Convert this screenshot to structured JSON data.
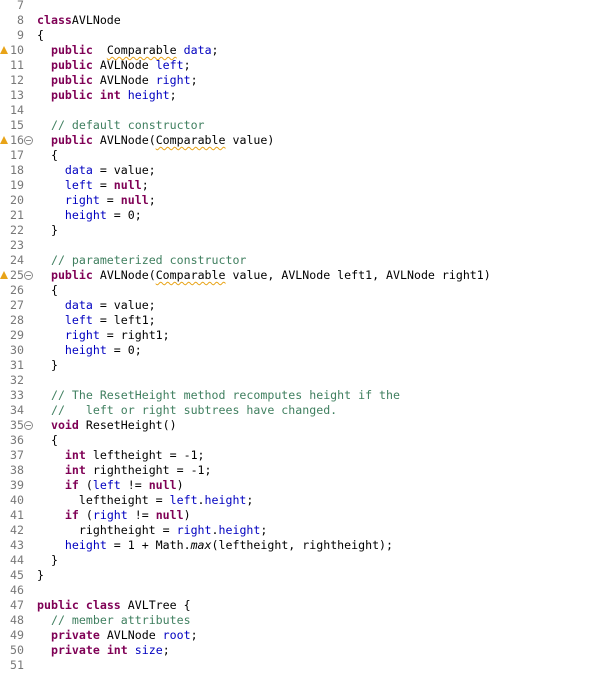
{
  "editor": {
    "language": "java",
    "first_line_number": 7,
    "colors": {
      "keyword": "#7f0055",
      "field": "#0000c0",
      "comment": "#3f7f5f",
      "line_number": "#787878",
      "warning_marker": "#e8a317"
    },
    "lines": [
      {
        "n": "7",
        "tokens": []
      },
      {
        "n": "8",
        "tokens": [
          [
            "kw",
            "class"
          ],
          [
            "",
            "AVLNode"
          ]
        ]
      },
      {
        "n": "9",
        "tokens": [
          [
            "",
            "{"
          ]
        ]
      },
      {
        "n": "10",
        "warn": true,
        "tokens": [
          [
            "",
            "  "
          ],
          [
            "kw",
            "public"
          ],
          [
            "",
            "  "
          ],
          [
            "sq",
            "Comparable"
          ],
          [
            "",
            " "
          ],
          [
            "fld",
            "data"
          ],
          [
            "",
            ";"
          ]
        ]
      },
      {
        "n": "11",
        "tokens": [
          [
            "",
            "  "
          ],
          [
            "kw",
            "public"
          ],
          [
            "",
            " AVLNode "
          ],
          [
            "fld",
            "left"
          ],
          [
            "",
            ";"
          ]
        ]
      },
      {
        "n": "12",
        "tokens": [
          [
            "",
            "  "
          ],
          [
            "kw",
            "public"
          ],
          [
            "",
            " AVLNode "
          ],
          [
            "fld",
            "right"
          ],
          [
            "",
            ";"
          ]
        ]
      },
      {
        "n": "13",
        "tokens": [
          [
            "",
            "  "
          ],
          [
            "kw",
            "public"
          ],
          [
            "",
            " "
          ],
          [
            "kw",
            "int"
          ],
          [
            "",
            " "
          ],
          [
            "fld",
            "height"
          ],
          [
            "",
            ";"
          ]
        ]
      },
      {
        "n": "14",
        "tokens": []
      },
      {
        "n": "15",
        "tokens": [
          [
            "",
            "  "
          ],
          [
            "cm",
            "// default constructor"
          ]
        ]
      },
      {
        "n": "16",
        "warn": true,
        "fold": true,
        "tokens": [
          [
            "",
            "  "
          ],
          [
            "kw",
            "public"
          ],
          [
            "",
            " AVLNode("
          ],
          [
            "sq",
            "Comparable"
          ],
          [
            "",
            " value)"
          ]
        ]
      },
      {
        "n": "17",
        "tokens": [
          [
            "",
            "  {"
          ]
        ]
      },
      {
        "n": "18",
        "tokens": [
          [
            "",
            "    "
          ],
          [
            "fld",
            "data"
          ],
          [
            "",
            " = value;"
          ]
        ]
      },
      {
        "n": "19",
        "tokens": [
          [
            "",
            "    "
          ],
          [
            "fld",
            "left"
          ],
          [
            "",
            " = "
          ],
          [
            "kw",
            "null"
          ],
          [
            "",
            ";"
          ]
        ]
      },
      {
        "n": "20",
        "tokens": [
          [
            "",
            "    "
          ],
          [
            "fld",
            "right"
          ],
          [
            "",
            " = "
          ],
          [
            "kw",
            "null"
          ],
          [
            "",
            ";"
          ]
        ]
      },
      {
        "n": "21",
        "tokens": [
          [
            "",
            "    "
          ],
          [
            "fld",
            "height"
          ],
          [
            "",
            " = 0;"
          ]
        ]
      },
      {
        "n": "22",
        "tokens": [
          [
            "",
            "  }"
          ]
        ]
      },
      {
        "n": "23",
        "tokens": []
      },
      {
        "n": "24",
        "tokens": [
          [
            "",
            "  "
          ],
          [
            "cm",
            "// parameterized constructor"
          ]
        ]
      },
      {
        "n": "25",
        "warn": true,
        "fold": true,
        "tokens": [
          [
            "",
            "  "
          ],
          [
            "kw",
            "public"
          ],
          [
            "",
            " AVLNode("
          ],
          [
            "sq",
            "Comparable"
          ],
          [
            "",
            " value, AVLNode left1, AVLNode right1)"
          ]
        ]
      },
      {
        "n": "26",
        "tokens": [
          [
            "",
            "  {"
          ]
        ]
      },
      {
        "n": "27",
        "tokens": [
          [
            "",
            "    "
          ],
          [
            "fld",
            "data"
          ],
          [
            "",
            " = value;"
          ]
        ]
      },
      {
        "n": "28",
        "tokens": [
          [
            "",
            "    "
          ],
          [
            "fld",
            "left"
          ],
          [
            "",
            " = left1;"
          ]
        ]
      },
      {
        "n": "29",
        "tokens": [
          [
            "",
            "    "
          ],
          [
            "fld",
            "right"
          ],
          [
            "",
            " = right1;"
          ]
        ]
      },
      {
        "n": "30",
        "tokens": [
          [
            "",
            "    "
          ],
          [
            "fld",
            "height"
          ],
          [
            "",
            " = 0;"
          ]
        ]
      },
      {
        "n": "31",
        "tokens": [
          [
            "",
            "  }"
          ]
        ]
      },
      {
        "n": "32",
        "tokens": []
      },
      {
        "n": "33",
        "tokens": [
          [
            "",
            "  "
          ],
          [
            "cm",
            "// The ResetHeight method recomputes height if the"
          ]
        ]
      },
      {
        "n": "34",
        "tokens": [
          [
            "",
            "  "
          ],
          [
            "cm",
            "//   left or right subtrees have changed."
          ]
        ]
      },
      {
        "n": "35",
        "fold": true,
        "tokens": [
          [
            "",
            "  "
          ],
          [
            "kw",
            "void"
          ],
          [
            "",
            " ResetHeight()"
          ]
        ]
      },
      {
        "n": "36",
        "tokens": [
          [
            "",
            "  {"
          ]
        ]
      },
      {
        "n": "37",
        "tokens": [
          [
            "",
            "    "
          ],
          [
            "kw",
            "int"
          ],
          [
            "",
            " leftheight = -1;"
          ]
        ]
      },
      {
        "n": "38",
        "tokens": [
          [
            "",
            "    "
          ],
          [
            "kw",
            "int"
          ],
          [
            "",
            " rightheight = -1;"
          ]
        ]
      },
      {
        "n": "39",
        "tokens": [
          [
            "",
            "    "
          ],
          [
            "kw",
            "if"
          ],
          [
            "",
            " ("
          ],
          [
            "fld",
            "left"
          ],
          [
            "",
            " != "
          ],
          [
            "kw",
            "null"
          ],
          [
            "",
            ")"
          ]
        ]
      },
      {
        "n": "40",
        "tokens": [
          [
            "",
            "      leftheight = "
          ],
          [
            "fld",
            "left"
          ],
          [
            "",
            "."
          ],
          [
            "fld",
            "height"
          ],
          [
            "",
            ";"
          ]
        ]
      },
      {
        "n": "41",
        "tokens": [
          [
            "",
            "    "
          ],
          [
            "kw",
            "if"
          ],
          [
            "",
            " ("
          ],
          [
            "fld",
            "right"
          ],
          [
            "",
            " != "
          ],
          [
            "kw",
            "null"
          ],
          [
            "",
            ")"
          ]
        ]
      },
      {
        "n": "42",
        "tokens": [
          [
            "",
            "      rightheight = "
          ],
          [
            "fld",
            "right"
          ],
          [
            "",
            "."
          ],
          [
            "fld",
            "height"
          ],
          [
            "",
            ";"
          ]
        ]
      },
      {
        "n": "43",
        "tokens": [
          [
            "",
            "    "
          ],
          [
            "fld",
            "height"
          ],
          [
            "",
            " = 1 + Math."
          ],
          [
            "it",
            "max"
          ],
          [
            "",
            "(leftheight, rightheight);"
          ]
        ]
      },
      {
        "n": "44",
        "tokens": [
          [
            "",
            "  }"
          ]
        ]
      },
      {
        "n": "45",
        "tokens": [
          [
            "",
            "}"
          ]
        ]
      },
      {
        "n": "46",
        "tokens": []
      },
      {
        "n": "47",
        "tokens": [
          [
            "kw",
            "public"
          ],
          [
            "",
            " "
          ],
          [
            "kw",
            "class"
          ],
          [
            "",
            " AVLTree {"
          ]
        ]
      },
      {
        "n": "48",
        "tokens": [
          [
            "",
            "  "
          ],
          [
            "cm",
            "// member attributes"
          ]
        ]
      },
      {
        "n": "49",
        "tokens": [
          [
            "",
            "  "
          ],
          [
            "kw",
            "private"
          ],
          [
            "",
            " AVLNode "
          ],
          [
            "fld",
            "root"
          ],
          [
            "",
            ";"
          ]
        ]
      },
      {
        "n": "50",
        "tokens": [
          [
            "",
            "  "
          ],
          [
            "kw",
            "private"
          ],
          [
            "",
            " "
          ],
          [
            "kw",
            "int"
          ],
          [
            "",
            " "
          ],
          [
            "fld",
            "size"
          ],
          [
            "",
            ";"
          ]
        ]
      },
      {
        "n": "51",
        "tokens": []
      }
    ]
  }
}
